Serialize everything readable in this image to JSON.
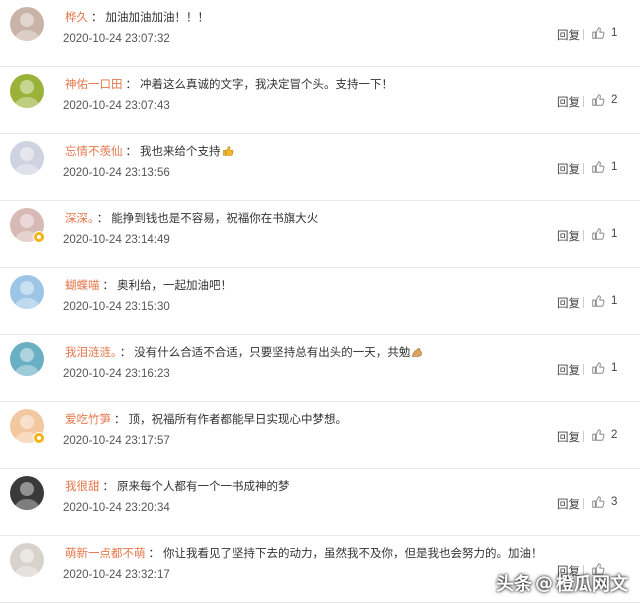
{
  "comments": [
    {
      "user": "桦久",
      "text": "加油加油加油！！！",
      "time": "2020-10-24 23:07:32",
      "reply": "回复",
      "likes": "1",
      "avatar_color": "#c9b2a6",
      "vip": false,
      "emoji": ""
    },
    {
      "user": "神佑一口田",
      "text": "冲着这么真诚的文字，我决定冒个头。支持一下！",
      "time": "2020-10-24 23:07:43",
      "reply": "回复",
      "likes": "2",
      "avatar_color": "#9bb23a",
      "vip": false,
      "emoji": ""
    },
    {
      "user": "忘情不羡仙",
      "text": "我也来给个支持",
      "time": "2020-10-24 23:13:56",
      "reply": "回复",
      "likes": "1",
      "avatar_color": "#cfd2e0",
      "vip": false,
      "emoji": "thumbs-up"
    },
    {
      "user": "深深。",
      "text": "能挣到钱也是不容易，祝福你在书旗大火",
      "time": "2020-10-24 23:14:49",
      "reply": "回复",
      "likes": "1",
      "avatar_color": "#d7b9b6",
      "vip": true,
      "emoji": ""
    },
    {
      "user": "蝴蝶喵",
      "text": "奥利给，一起加油吧！",
      "time": "2020-10-24 23:15:30",
      "reply": "回复",
      "likes": "1",
      "avatar_color": "#9dc6e6",
      "vip": false,
      "emoji": ""
    },
    {
      "user": "我泪涟涟。",
      "text": "没有什么合适不合适，只要坚持总有出头的一天，共勉",
      "time": "2020-10-24 23:16:23",
      "reply": "回复",
      "likes": "1",
      "avatar_color": "#6ab0c4",
      "vip": false,
      "emoji": "muscle"
    },
    {
      "user": "爱吃竹笋",
      "text": "顶，祝福所有作者都能早日实现心中梦想。",
      "time": "2020-10-24 23:17:57",
      "reply": "回复",
      "likes": "2",
      "avatar_color": "#f2c8a0",
      "vip": true,
      "emoji": ""
    },
    {
      "user": "我很甜",
      "text": "原来每个人都有一个一书成神的梦",
      "time": "2020-10-24 23:20:34",
      "reply": "回复",
      "likes": "3",
      "avatar_color": "#3a3a3a",
      "vip": false,
      "emoji": ""
    },
    {
      "user": "萌新一点都不萌",
      "text": "你让我看见了坚持下去的动力，虽然我不及你，但是我也会努力的。加油！",
      "time": "2020-10-24 23:32:17",
      "reply": "回复",
      "likes": "",
      "avatar_color": "#d8d2cc",
      "vip": false,
      "emoji": ""
    }
  ],
  "separator": "：",
  "watermark": {
    "platform": "头条",
    "at": "@",
    "author": "橙瓜网文"
  },
  "colors": {
    "username": "#e5764a",
    "vip_badge": "#f3b41b"
  }
}
